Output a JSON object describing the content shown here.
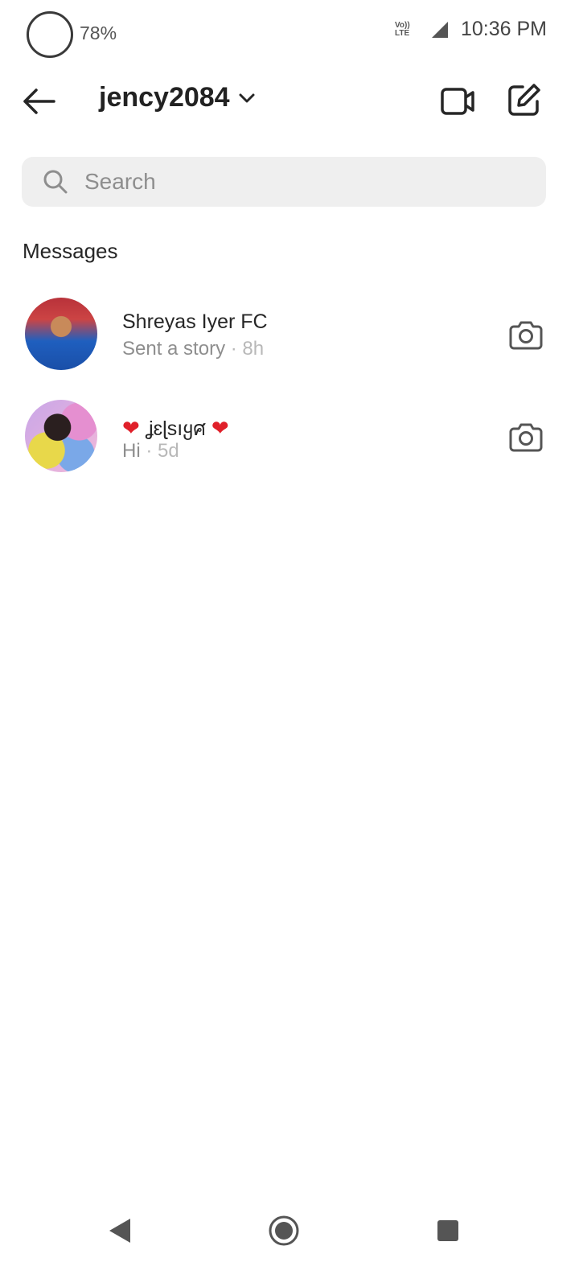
{
  "status_bar": {
    "battery_percent": "78%",
    "network_label_top": "Vo)) LTE",
    "network_label_side": "LTE",
    "time": "10:36 PM"
  },
  "header": {
    "account_name": "jency2084"
  },
  "search": {
    "placeholder": "Search"
  },
  "messages_section": {
    "title": "Messages"
  },
  "conversations": [
    {
      "name": "Shreyas Iyer FC",
      "preview": "Sent a story",
      "time_ago": "8h"
    },
    {
      "name_prefix_icon": "heart-emoji",
      "name": "ʝɛɭsıყศ",
      "name_suffix_icon": "heart-emoji",
      "preview": "Hi",
      "time_ago": "5d"
    }
  ],
  "icons": {
    "back": "arrow-left-icon",
    "chevron": "chevron-down-icon",
    "video": "video-camera-icon",
    "compose": "compose-icon",
    "search": "search-icon",
    "camera": "camera-icon"
  },
  "colors": {
    "heart": "#e0202a",
    "search_bg": "#efefef",
    "secondary_text": "#8e8e8e"
  }
}
